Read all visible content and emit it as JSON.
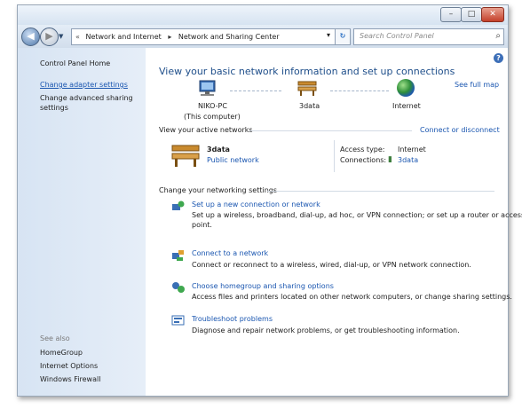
{
  "window": {
    "min_glyph": "–",
    "max_glyph": "□",
    "close_glyph": "✕"
  },
  "address": {
    "chevron": "«",
    "crumbs": [
      "Network and Internet",
      "Network and Sharing Center"
    ],
    "separator": "▸",
    "search_placeholder": "Search Control Panel"
  },
  "sidebar": {
    "home": "Control Panel Home",
    "links": [
      "Change adapter settings",
      "Change advanced sharing settings"
    ],
    "see_also_title": "See also",
    "see_also": [
      "HomeGroup",
      "Internet Options",
      "Windows Firewall"
    ]
  },
  "main": {
    "title": "View your basic network information and set up connections",
    "see_full_map": "See full map",
    "map": {
      "computer_name": "NIKO-PC",
      "computer_note": "(This computer)",
      "network": "3data",
      "internet": "Internet"
    },
    "active": {
      "title": "View your active networks",
      "connect_link": "Connect or disconnect",
      "network_name": "3data",
      "network_type": "Public network",
      "access_label": "Access type:",
      "access_value": "Internet",
      "connections_label": "Connections:",
      "connections_value": "3data"
    },
    "settings_title": "Change your networking settings",
    "tasks": [
      {
        "icon": "new-connection-icon",
        "title": "Set up a new connection or network",
        "desc1": "Set up a wireless, broadband, dial-up, ad hoc, or VPN connection; or set up a router or access",
        "desc2": "point."
      },
      {
        "icon": "connect-network-icon",
        "title": "Connect to a network",
        "desc1": "Connect or reconnect to a wireless, wired, dial-up, or VPN network connection.",
        "desc2": ""
      },
      {
        "icon": "homegroup-icon",
        "title": "Choose homegroup and sharing options",
        "desc1": "Access files and printers located on other network computers, or change sharing settings.",
        "desc2": ""
      },
      {
        "icon": "troubleshoot-icon",
        "title": "Troubleshoot problems",
        "desc1": "Diagnose and repair network problems, or get troubleshooting information.",
        "desc2": ""
      }
    ]
  },
  "colors": {
    "link": "#1a56b0",
    "title": "#1e4e8a",
    "sidebar": "#dce7f4"
  }
}
